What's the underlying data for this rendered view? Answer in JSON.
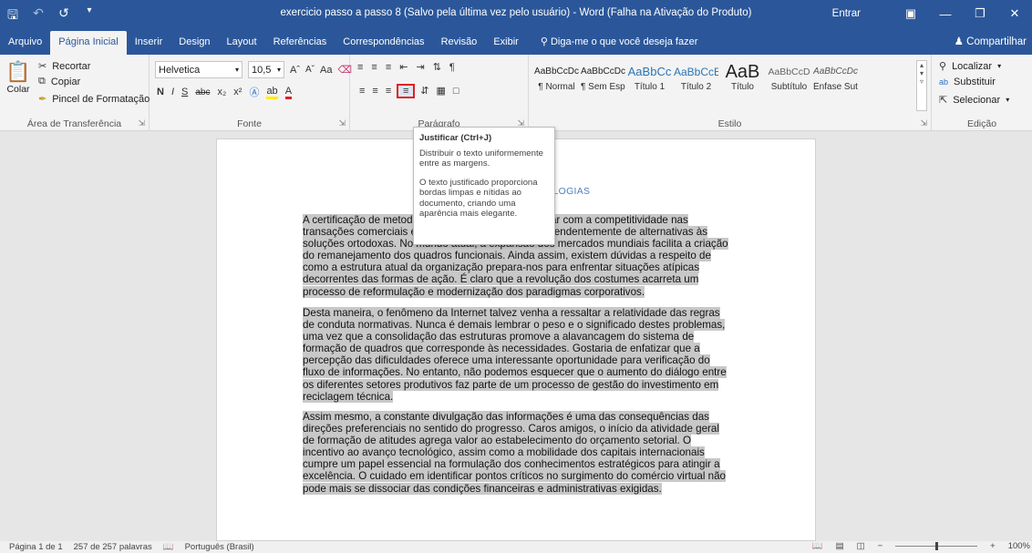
{
  "titlebar": {
    "title": "exercicio passo a passo 8 (Salvo pela última vez pelo usuário)  -  Word (Falha na Ativação do Produto)",
    "signin": "Entrar",
    "icons": [
      "save-icon",
      "undo-icon",
      "redo-icon",
      "customize-qat-icon"
    ]
  },
  "tabs": [
    {
      "label": "Arquivo"
    },
    {
      "label": "Página Inicial"
    },
    {
      "label": "Inserir"
    },
    {
      "label": "Design"
    },
    {
      "label": "Layout"
    },
    {
      "label": "Referências"
    },
    {
      "label": "Correspondências"
    },
    {
      "label": "Revisão"
    },
    {
      "label": "Exibir"
    }
  ],
  "tell_me": "Diga-me o que você deseja fazer",
  "share": "Compartilhar",
  "clipboard": {
    "paste": "Colar",
    "cut": "Recortar",
    "copy": "Copiar",
    "format_painter": "Pincel de Formatação",
    "label": "Área de Transferência"
  },
  "font": {
    "family": "Helvetica",
    "size": "10,5",
    "label": "Fonte",
    "bold": "N",
    "italic": "I",
    "underline": "S",
    "strike": "abc",
    "sub": "x₂",
    "sup": "x²",
    "case": "Aa"
  },
  "paragraph": {
    "label": "Parágrafo"
  },
  "styles": {
    "label": "Estilo",
    "items": [
      {
        "preview": "AaBbCcDc",
        "name": "¶ Normal"
      },
      {
        "preview": "AaBbCcDc",
        "name": "¶ Sem Esp..."
      },
      {
        "preview": "AaBbCc",
        "name": "Título 1"
      },
      {
        "preview": "AaBbCcE",
        "name": "Título 2"
      },
      {
        "preview": "AaB",
        "name": "Título"
      },
      {
        "preview": "AaBbCcD",
        "name": "Subtítulo"
      },
      {
        "preview": "AaBbCcDc",
        "name": "Ênfase Sutil"
      }
    ]
  },
  "editing": {
    "label": "Edição",
    "find": "Localizar",
    "replace": "Substituir",
    "select": "Selecionar"
  },
  "tooltip": {
    "title": "Justificar (Ctrl+J)",
    "p1": "Distribuir o texto uniformemente entre as margens.",
    "p2": "O texto justificado proporciona bordas limpas e nítidas ao documento, criando uma aparência mais elegante."
  },
  "document": {
    "title_fragment": "OLOGIAS",
    "paragraphs": [
      "A certificação de metodologias que nos auxiliam a lidar com a competitividade nas transações comerciais estimula a padronização independentemente de alternativas às soluções ortodoxas. No mundo atual, a expansão dos mercados mundiais facilita a criação do remanejamento dos quadros funcionais. Ainda assim, existem dúvidas a respeito de como a estrutura atual da organização prepara-nos para enfrentar situações atípicas decorrentes das formas de ação. É claro que a revolução dos costumes acarreta um processo de reformulação e modernização dos paradigmas corporativos.",
      "Desta maneira, o fenômeno da Internet talvez venha a ressaltar a relatividade das regras de conduta normativas. Nunca é demais lembrar o peso e o significado destes problemas, uma vez que a consolidação das estruturas promove a alavancagem do sistema de formação de quadros que corresponde às necessidades. Gostaria de enfatizar que a percepção das dificuldades oferece uma interessante oportunidade para verificação do fluxo de informações. No entanto, não podemos esquecer que o aumento do diálogo entre os diferentes setores produtivos faz parte de um processo de gestão do investimento em reciclagem técnica.",
      "Assim mesmo, a constante divulgação das informações é uma das consequências das direções preferenciais no sentido do progresso. Caros amigos, o início da atividade geral de formação de atitudes agrega valor ao estabelecimento do orçamento setorial. O incentivo ao avanço tecnológico, assim como a mobilidade dos capitais internacionais cumpre um papel essencial na formulação dos conhecimentos estratégicos para atingir a excelência. O cuidado em identificar pontos críticos no surgimento do comércio virtual não pode mais se dissociar das condições financeiras e administrativas exigidas."
    ]
  },
  "status": {
    "page": "Página 1 de 1",
    "words": "257 de 257 palavras",
    "language": "Português (Brasil)",
    "zoom": "100%"
  }
}
